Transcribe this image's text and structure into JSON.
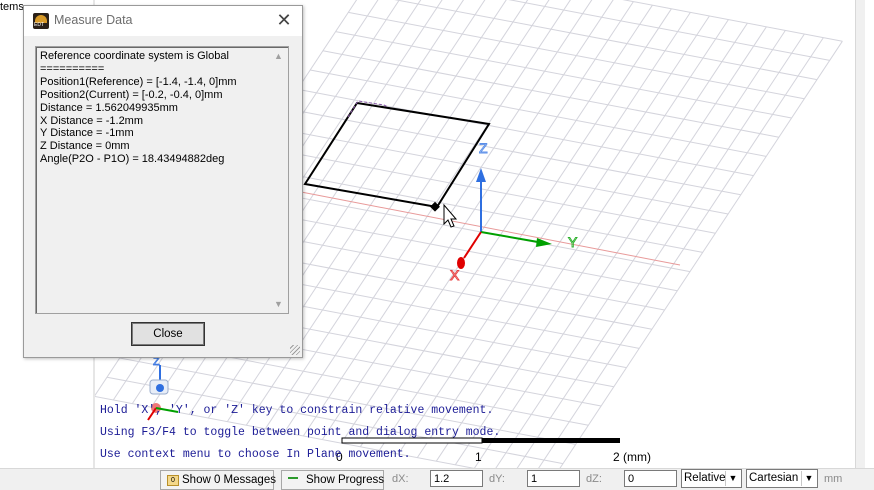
{
  "left_panel": {
    "label": "tems"
  },
  "dialog": {
    "title": "Measure Data",
    "lines": [
      "Reference coordinate system is Global",
      "==========",
      "Position1(Reference) = [-1.4, -1.4, 0]mm",
      "Position2(Current) = [-0.2, -0.4, 0]mm",
      "Distance = 1.562049935mm",
      "X Distance = -1.2mm",
      "Y Distance = -1mm",
      "Z Distance = 0mm",
      "Angle(P2O - P1O) = 18.43494882deg"
    ],
    "close_button": "Close"
  },
  "viewport": {
    "axes": {
      "x": "X",
      "y": "Y",
      "z": "Z"
    },
    "messages": [
      "Hold 'X', 'Y', or 'Z' key to constrain relative movement.",
      "Using F3/F4 to toggle between point and dialog entry mode.",
      "Use context menu to choose In Plane movement."
    ],
    "ruler": {
      "tick_0": "0",
      "tick_1": "1",
      "tick_2": "2 (mm)"
    },
    "colors": {
      "x_axis": "#e00000",
      "y_axis": "#00a000",
      "z_axis": "#2f6fe0",
      "message": "#1c1c96"
    }
  },
  "statusbar": {
    "messages_button": "Show 0 Messages",
    "progress_button": "Show Progress",
    "dx_label": "dX:",
    "dx_value": "1.2",
    "dy_label": "dY:",
    "dy_value": "1",
    "dz_label": "dZ:",
    "dz_value": "0",
    "mode": "Relative",
    "coord_system": "Cartesian",
    "unit": "mm"
  }
}
